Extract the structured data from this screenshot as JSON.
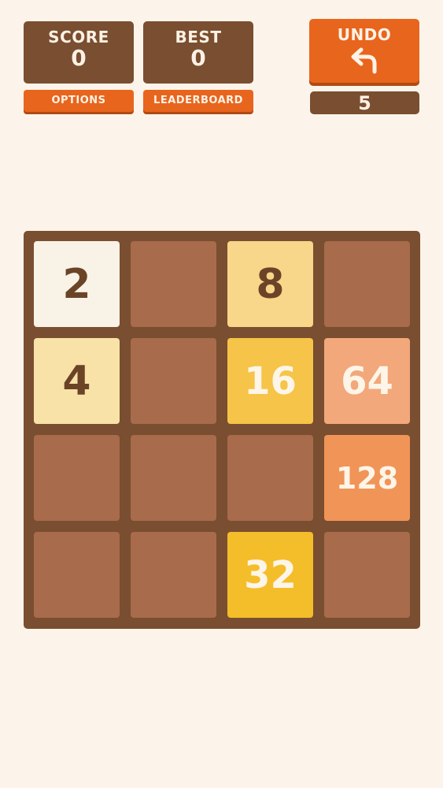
{
  "header": {
    "score": {
      "label": "SCORE",
      "value": "0"
    },
    "best": {
      "label": "BEST",
      "value": "0"
    },
    "options_label": "OPTIONS",
    "leaderboard_label": "LEADERBOARD",
    "undo": {
      "label": "UNDO",
      "icon": "undo-arrow-icon",
      "remaining": "5"
    }
  },
  "board": {
    "size": 4,
    "rows": [
      [
        "2",
        "",
        "8",
        ""
      ],
      [
        "4",
        "",
        "16",
        "64"
      ],
      [
        "",
        "",
        "",
        "128"
      ],
      [
        "",
        "",
        "32",
        ""
      ]
    ]
  },
  "colors": {
    "background": "#fcf4ea",
    "board": "#7a4e30",
    "empty_cell": "#a86b4b",
    "accent_button": "#e8651d",
    "tiles": {
      "2": {
        "bg": "#f9f3e7",
        "fg": "#6b4428"
      },
      "4": {
        "bg": "#f8e2a8",
        "fg": "#6b4428"
      },
      "8": {
        "bg": "#f8d68a",
        "fg": "#6b4428"
      },
      "16": {
        "bg": "#f5c448",
        "fg": "#fdf5e8"
      },
      "32": {
        "bg": "#f4bd2a",
        "fg": "#fdf5e8"
      },
      "64": {
        "bg": "#f2a87a",
        "fg": "#fdf5e8"
      },
      "128": {
        "bg": "#f19457",
        "fg": "#fdf5e8"
      }
    }
  }
}
